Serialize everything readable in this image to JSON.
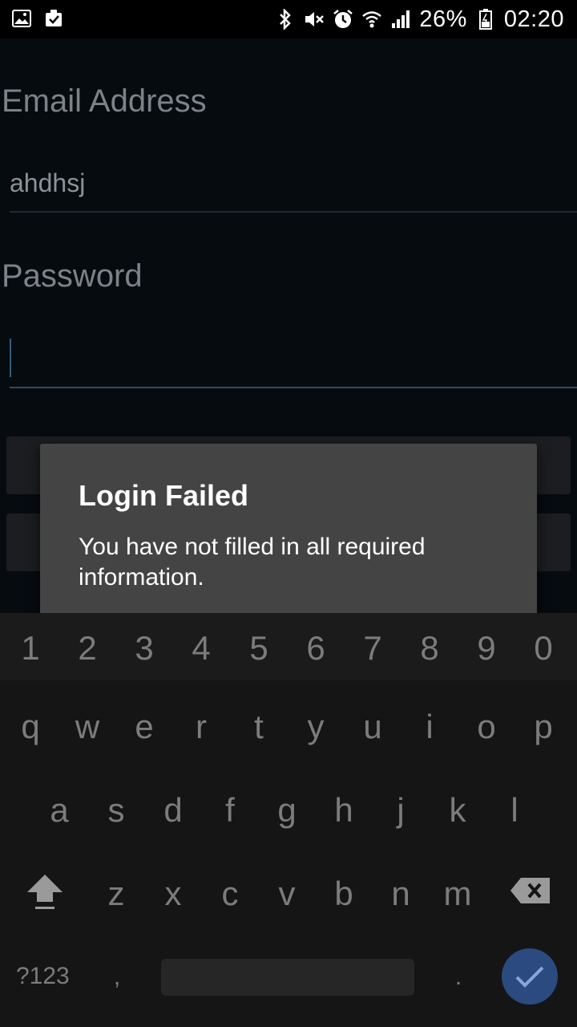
{
  "status_bar": {
    "battery": "26%",
    "time": "02:20"
  },
  "form": {
    "email_label": "Email Address",
    "email_value": "ahdhsj",
    "password_label": "Password",
    "password_value": ""
  },
  "dialog": {
    "title": "Login Failed",
    "message": "You have not filled in all required information."
  },
  "keyboard": {
    "numbers": [
      "1",
      "2",
      "3",
      "4",
      "5",
      "6",
      "7",
      "8",
      "9",
      "0"
    ],
    "row1": [
      "q",
      "w",
      "e",
      "r",
      "t",
      "y",
      "u",
      "i",
      "o",
      "p"
    ],
    "row2": [
      "a",
      "s",
      "d",
      "f",
      "g",
      "h",
      "j",
      "k",
      "l"
    ],
    "row3": [
      "z",
      "x",
      "c",
      "v",
      "b",
      "n",
      "m"
    ],
    "symbols_label": "?123",
    "comma": ",",
    "period": "."
  },
  "colors": {
    "accent": "#2b4a80",
    "dialog_bg": "#444444"
  }
}
